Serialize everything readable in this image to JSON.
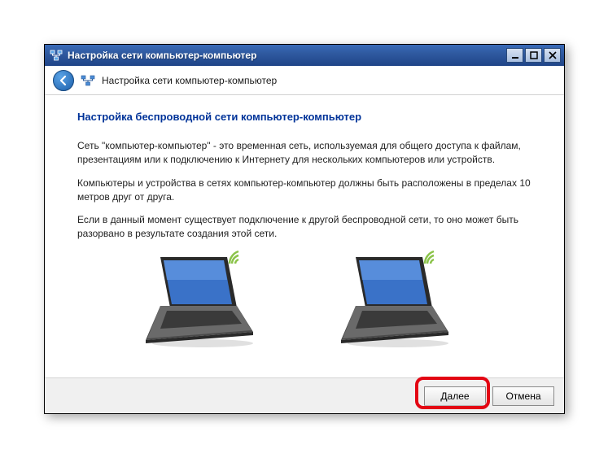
{
  "window": {
    "title": "Настройка сети компьютер-компьютер"
  },
  "header": {
    "title": "Настройка сети компьютер-компьютер"
  },
  "content": {
    "heading": "Настройка беспроводной сети компьютер-компьютер",
    "p1": "Сеть \"компьютер-компьютер\" - это временная сеть, используемая для общего доступа к файлам, презентациям или к подключению к Интернету для нескольких компьютеров или устройств.",
    "p2": "Компьютеры и устройства в сетях компьютер-компьютер должны быть расположены в пределах 10 метров друг от друга.",
    "p3": "Если в данный момент существует подключение к другой беспроводной сети, то оно может быть разорвано в результате создания этой сети."
  },
  "footer": {
    "next": "Далее",
    "cancel": "Отмена"
  }
}
